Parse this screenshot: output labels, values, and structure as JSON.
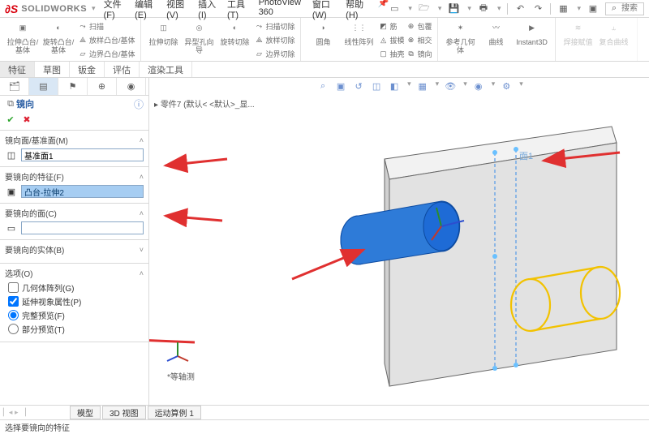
{
  "app": {
    "brand_prefix": "S",
    "brand_name": "SOLIDWORKS"
  },
  "menu": {
    "file": "文件(F)",
    "edit": "编辑(E)",
    "view": "视图(V)",
    "insert": "插入(I)",
    "tools": "工具(T)",
    "pv360": "PhotoView 360",
    "window": "窗口(W)",
    "help": "帮助(H)"
  },
  "search": {
    "placeholder": "搜索",
    "prefix": "⌕"
  },
  "ribbon": {
    "g1a": "拉伸凸台/基体",
    "g1b": "旋转凸台/基体",
    "g1s1": "扫描",
    "g1s2": "放样凸台/基体",
    "g1s3": "边界凸台/基体",
    "g2a": "拉伸切除",
    "g2b": "异型孔向导",
    "g2c": "旋转切除",
    "g2s1": "扫描切除",
    "g2s2": "放样切除",
    "g2s3": "边界切除",
    "g3a": "圆角",
    "g3b": "线性阵列",
    "g3s1": "筋",
    "g3s2": "拔模",
    "g3s3": "抽壳",
    "g3s4": "包覆",
    "g3s5": "相交",
    "g3s6": "镜向",
    "g4a": "参考几何体",
    "g4b": "曲线",
    "g4c": "Instant3D",
    "g5a": "焊接赋值",
    "g5b": "复合曲线"
  },
  "ftabs": {
    "feature": "特征",
    "sketch": "草图",
    "sheetmetal": "钣金",
    "evaluate": "评估",
    "render": "渲染工具"
  },
  "breadcrumb": "零件7  (默认< <默认>_显...",
  "pm": {
    "title": "镜向",
    "sec_mirror_plane": "镜向面/基准面(M)",
    "mirror_plane_val": "基准面1",
    "sec_features": "要镜向的特征(F)",
    "feature_val": "凸台-拉伸2",
    "sec_faces": "要镜向的面(C)",
    "faces_val": "",
    "sec_bodies": "要镜向的实体(B)",
    "sec_options": "选项(O)",
    "opt_geom_pattern": "几何体阵列(G)",
    "opt_propagate": "延伸视象属性(P)",
    "opt_full": "完整预览(F)",
    "opt_partial": "部分预览(T)"
  },
  "viewport": {
    "view_name": "*等轴测",
    "face_label": "面1"
  },
  "bottom": {
    "model": "模型",
    "view3d": "3D 视图",
    "motion": "运动算例 1"
  },
  "status": "选择要镜向的特征"
}
